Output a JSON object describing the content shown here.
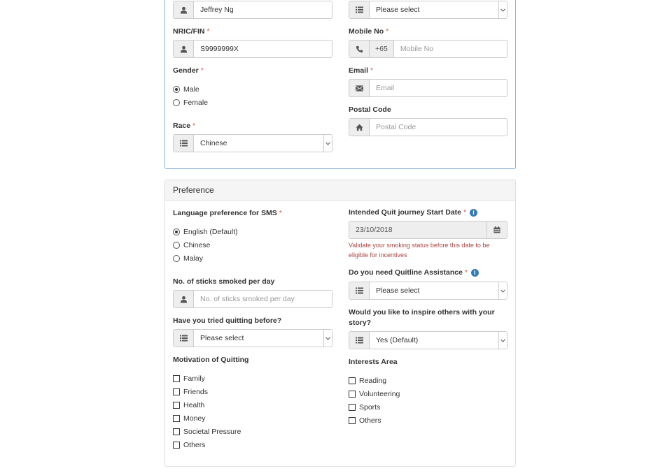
{
  "personal": {
    "name_value": "Jeffrey Ng",
    "top_right_select": "Please select",
    "nric_label": "NRIC/FIN",
    "nric_value": "S9999999X",
    "mobile_label": "Mobile No",
    "mobile_prefix": "+65",
    "mobile_placeholder": "Mobile No",
    "gender_label": "Gender",
    "gender_options": [
      "Male",
      "Female"
    ],
    "email_label": "Email",
    "email_placeholder": "Email",
    "postal_label": "Postal Code",
    "postal_placeholder": "Postal Code",
    "race_label": "Race",
    "race_value": "Chinese",
    "required_mark": "*"
  },
  "preference": {
    "title": "Preference",
    "lang_label": "Language preference for SMS",
    "lang_options": [
      "English (Default)",
      "Chinese",
      "Malay"
    ],
    "sticks_label": "No. of sticks smoked per day",
    "sticks_placeholder": "No. of sticks smoked per day",
    "tried_label": "Have you tried quitting before?",
    "tried_value": "Please select",
    "motivation_label": "Motivation of Quitting",
    "motivation_options": [
      "Family",
      "Friends",
      "Health",
      "Money",
      "Societal Pressure",
      "Others"
    ],
    "quit_date_label": "Intended Quit journey Start Date",
    "quit_date_value": "23/10/2018",
    "quit_date_hint_1": "Validate your smoking status before this date to be",
    "quit_date_hint_2": "eligible for incentives",
    "assist_label": "Do you need Quitline Assistance",
    "assist_value": "Please select",
    "inspire_label_1": "Would you like to inspire others with your",
    "inspire_label_2": "story?",
    "inspire_value": "Yes (Default)",
    "interests_label": "Interests Area",
    "interests_options": [
      "Reading",
      "Volunteering",
      "Sports",
      "Others"
    ],
    "info_glyph": "i"
  },
  "icons": {
    "user": "user-icon",
    "list": "list-icon",
    "phone": "phone-icon",
    "envelope": "envelope-icon",
    "home": "home-icon",
    "calendar": "calendar-icon",
    "caret": "chevron-down-icon",
    "info": "info-icon"
  },
  "colors": {
    "accent_border": "#7fb2dc",
    "required": "#d9534f",
    "hint": "#a94442",
    "info": "#337ab7"
  }
}
